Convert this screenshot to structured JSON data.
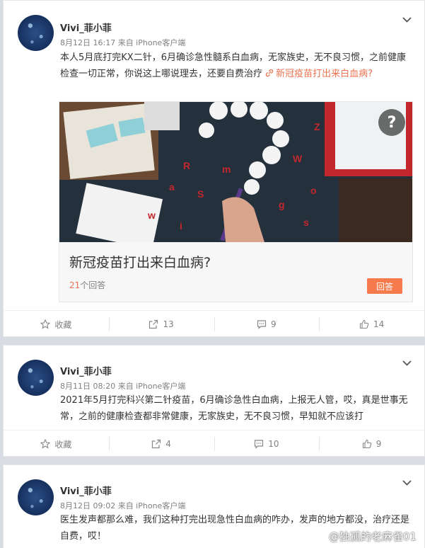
{
  "posts": [
    {
      "author": "Vivi_菲小菲",
      "meta": "8月12日 16:17 来自 iPhone客户端",
      "text": "本人5月底打完KX二针，6月确诊急性髓系白血病，无家族史，无不良习惯，之前健康检查一切正常，你说这上哪说理去，还要自费治疗 ",
      "link_text": "新冠疫苗打出来白血病?",
      "article": {
        "title": "新冠疫苗打出来白血病?",
        "answers_count": "21",
        "answers_suffix": "个回答",
        "answer_button": "回答",
        "help_icon": "?"
      },
      "actions": {
        "favorite": "收藏",
        "repost": "13",
        "comment": "9",
        "like": "14"
      }
    },
    {
      "author": "Vivi_菲小菲",
      "meta": "8月11日 08:20 来自 iPhone客户端",
      "text": "2021年5月打完科兴第二针疫苗，6月确诊急性白血病，上报无人管，哎，真是世事无常，之前的健康检查都非常健康，无家族史，无不良习惯，早知就不应该打",
      "actions": {
        "favorite": "收藏",
        "repost": "4",
        "comment": "10",
        "like": "9"
      }
    },
    {
      "author": "Vivi_菲小菲",
      "meta": "8月12日 09:02 来自 iPhone客户端",
      "text": "医生发声都那么难，我们这种打完出现急性白血病的咋办，发声的地方都没，治疗还是自费，哎！"
    }
  ],
  "watermark": "@独孤的老麻雀01",
  "icons": {
    "chevron": "chevron-down-icon",
    "star": "star-icon",
    "repost": "repost-icon",
    "comment": "comment-icon",
    "like": "like-icon",
    "link": "link-icon"
  },
  "colors": {
    "accent": "#eb7350",
    "button": "#f57b4c",
    "text": "#333333",
    "muted": "#808080",
    "background": "#d9dde3"
  }
}
